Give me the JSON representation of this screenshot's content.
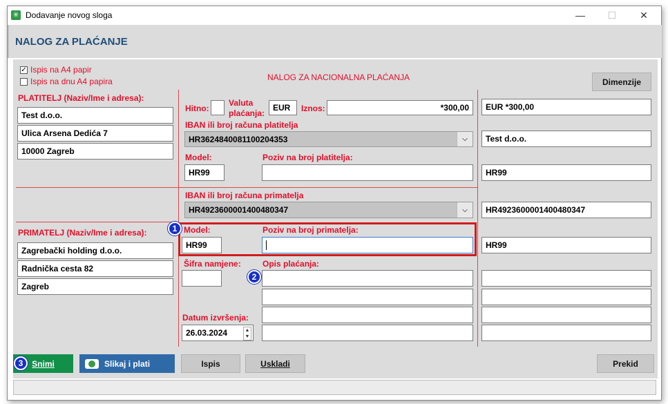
{
  "window": {
    "title": "Dodavanje novog sloga",
    "minimize_glyph": "—",
    "maximize_glyph": "☐",
    "close_glyph": "✕",
    "app_icon_glyph": "✳"
  },
  "header": {
    "title": "NALOG ZA PLAĆANJE"
  },
  "options": {
    "a4_label": "Ispis na A4 papir",
    "a4_checked": true,
    "bottom_label": "Ispis na dnu A4 papira",
    "bottom_checked": false
  },
  "section_title": "NALOG ZA NACIONALNA PLAĆANJA",
  "dimenzije_label": "Dimenzije",
  "platitelj": {
    "label": "PLATITELJ (Naziv/Ime i adresa):",
    "lines": [
      "Test d.o.o.",
      "Ulica Arsena Dedića 7",
      "10000 Zagreb"
    ]
  },
  "payment": {
    "hitno_label": "Hitno:",
    "valuta_label_1": "Valuta",
    "valuta_label_2": "plaćanja:",
    "valuta_value": "EUR",
    "iznos_label": "Iznos:",
    "iznos_value": "*300,00",
    "iban_platitelja_label": "IBAN ili broj računa platitelja",
    "iban_platitelja_value": "HR3624840081100204353",
    "model_label": "Model:",
    "model_platitelja_value": "HR99",
    "poziv_platitelja_label": "Poziv na broj platitelja:",
    "poziv_platitelja_value": "",
    "iban_primatelja_label": "IBAN ili broj računa primatelja",
    "iban_primatelja_value": "HR4923600001400480347",
    "model_primatelja_label": "Model:",
    "model_primatelja_value": "HR99",
    "poziv_primatelja_label": "Poziv na broj primatelja:",
    "poziv_primatelja_value": "",
    "sifra_label": "Šifra namjene:",
    "sifra_value": "",
    "opis_label": "Opis plaćanja:",
    "opis_lines": [
      "",
      "",
      "",
      ""
    ],
    "datum_label": "Datum izvršenja:",
    "datum_value": "26.03.2024"
  },
  "primatelj": {
    "label": "PRIMATELJ (Naziv/Ime i adresa):",
    "lines": [
      "Zagrebački holding d.o.o.",
      "Radnička cesta 82",
      "Zagreb"
    ]
  },
  "summary": {
    "iznos": "EUR *300,00",
    "platitelj": "Test d.o.o.",
    "model_platitelja": "HR99",
    "iban_primatelja": "HR4923600001400480347",
    "model_primatelja": "HR99",
    "opis_lines": [
      "",
      "",
      "",
      ""
    ]
  },
  "badges": [
    "1",
    "2",
    "3"
  ],
  "buttons": {
    "snimi": "Snimi",
    "slikaj": "Slikaj i plati",
    "ispis": "Ispis",
    "uskladi": "Uskladi",
    "prekid": "Prekid"
  },
  "colors": {
    "accent_red": "#e0102a",
    "header_blue": "#1f4e79",
    "save_green": "#12904a",
    "photo_blue": "#2f6aa8",
    "badge_blue": "#1630c8"
  }
}
